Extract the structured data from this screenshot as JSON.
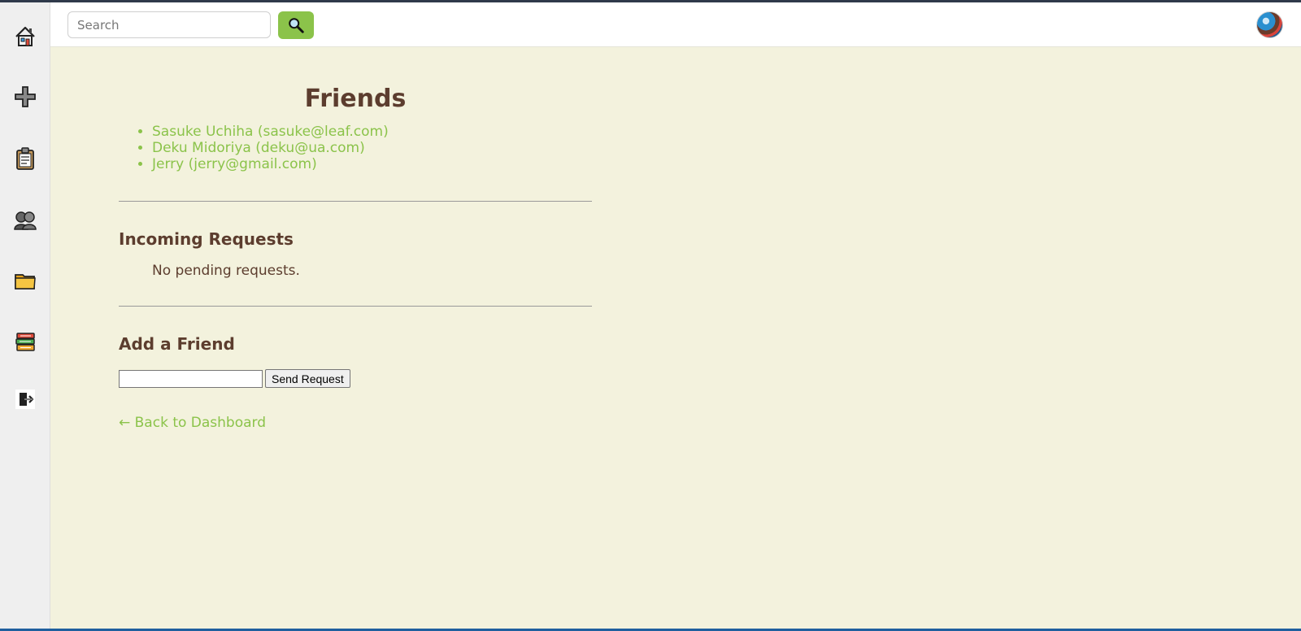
{
  "search": {
    "placeholder": "Search"
  },
  "sidebar": {
    "items": [
      {
        "icon": "home-icon"
      },
      {
        "icon": "plus-icon"
      },
      {
        "icon": "clipboard-icon"
      },
      {
        "icon": "friends-icon"
      },
      {
        "icon": "folder-icon"
      },
      {
        "icon": "books-icon"
      },
      {
        "icon": "logout-icon"
      }
    ]
  },
  "page": {
    "title": "Friends",
    "friends": [
      "Sasuke Uchiha (sasuke@leaf.com)",
      "Deku Midoriya (deku@ua.com)",
      "Jerry (jerry@gmail.com)"
    ],
    "incoming_title": "Incoming Requests",
    "incoming_empty": "No pending requests.",
    "add_title": "Add a Friend",
    "add_input_value": "",
    "send_label": "Send Request",
    "back_label": "← Back to Dashboard"
  },
  "colors": {
    "accent": "#8bc34a",
    "heading": "#5c3d2e",
    "background": "#f3f2dd",
    "sidebar": "#efefef"
  }
}
